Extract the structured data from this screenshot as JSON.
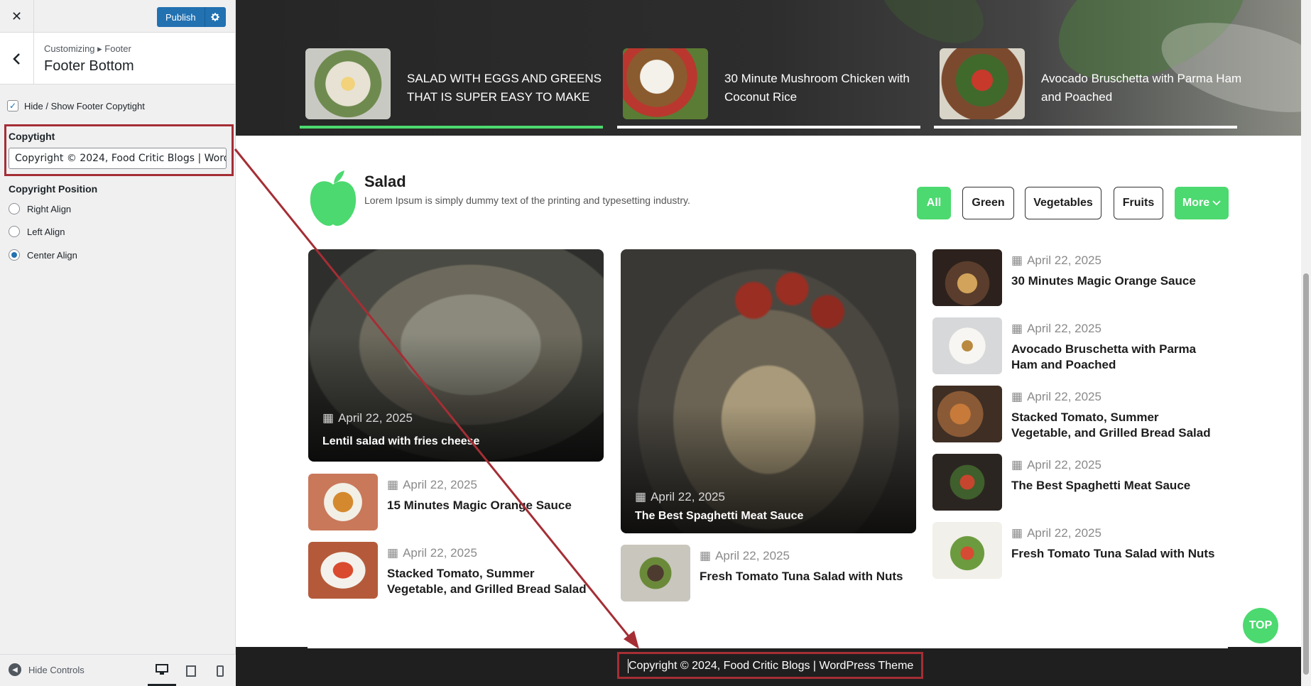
{
  "sidebar": {
    "close_label": "✕",
    "publish_label": "Publish",
    "breadcrumb": "Customizing ▸ Footer",
    "title": "Footer Bottom",
    "hide_show_label": "Hide / Show Footer Copytight",
    "hide_show_checked": true,
    "copyright_label": "Copytight",
    "copyright_value": "Copyright © 2024, Food Critic Blogs | WordPress Theme",
    "position_label": "Copyright Position",
    "positions": [
      {
        "label": "Right Align",
        "checked": false
      },
      {
        "label": "Left Align",
        "checked": false
      },
      {
        "label": "Center Align",
        "checked": true
      }
    ],
    "hide_controls_label": "Hide Controls"
  },
  "hero": {
    "slides": [
      {
        "title": "SALAD WITH EGGS AND GREENS THAT IS SUPER EASY TO MAKE",
        "active": true
      },
      {
        "title": "30 Minute Mushroom Chicken with Coconut Rice",
        "active": false
      },
      {
        "title": "Avocado Bruschetta with Parma Ham and Poached",
        "active": false
      }
    ]
  },
  "section": {
    "title": "Salad",
    "description": "Lorem Ipsum is simply dummy text of the printing and typesetting industry.",
    "filters": [
      "All",
      "Green",
      "Vegetables",
      "Fruits",
      "More"
    ]
  },
  "posts": {
    "big_left": {
      "date": "April 22, 2025",
      "title": "Lentil salad with fries cheese"
    },
    "big_middle": {
      "date": "April 22, 2025",
      "title": "The Best Spaghetti Meat Sauce"
    },
    "left_list": [
      {
        "date": "April 22, 2025",
        "title": "15 Minutes Magic Orange Sauce"
      },
      {
        "date": "April 22, 2025",
        "title": "Stacked Tomato, Summer Vegetable, and Grilled Bread Salad"
      }
    ],
    "middle_list": [
      {
        "date": "April 22, 2025",
        "title": "Fresh Tomato Tuna Salad with Nuts"
      }
    ],
    "right_list": [
      {
        "date": "April 22, 2025",
        "title": "30 Minutes Magic Orange Sauce"
      },
      {
        "date": "April 22, 2025",
        "title": "Avocado Bruschetta with Parma Ham and Poached"
      },
      {
        "date": "April 22, 2025",
        "title": "Stacked Tomato, Summer Vegetable, and Grilled Bread Salad"
      },
      {
        "date": "April 22, 2025",
        "title": "The Best Spaghetti Meat Sauce"
      },
      {
        "date": "April 22, 2025",
        "title": "Fresh Tomato Tuna Salad with Nuts"
      }
    ]
  },
  "top_button_label": "TOP",
  "footer": {
    "copyright": "Copyright © 2024, Food Critic Blogs | WordPress Theme"
  },
  "colors": {
    "accent_green": "#4cd96f",
    "wp_blue": "#2271b1",
    "highlight_red": "#a52e35",
    "footer_bg": "#1f1f1f"
  }
}
